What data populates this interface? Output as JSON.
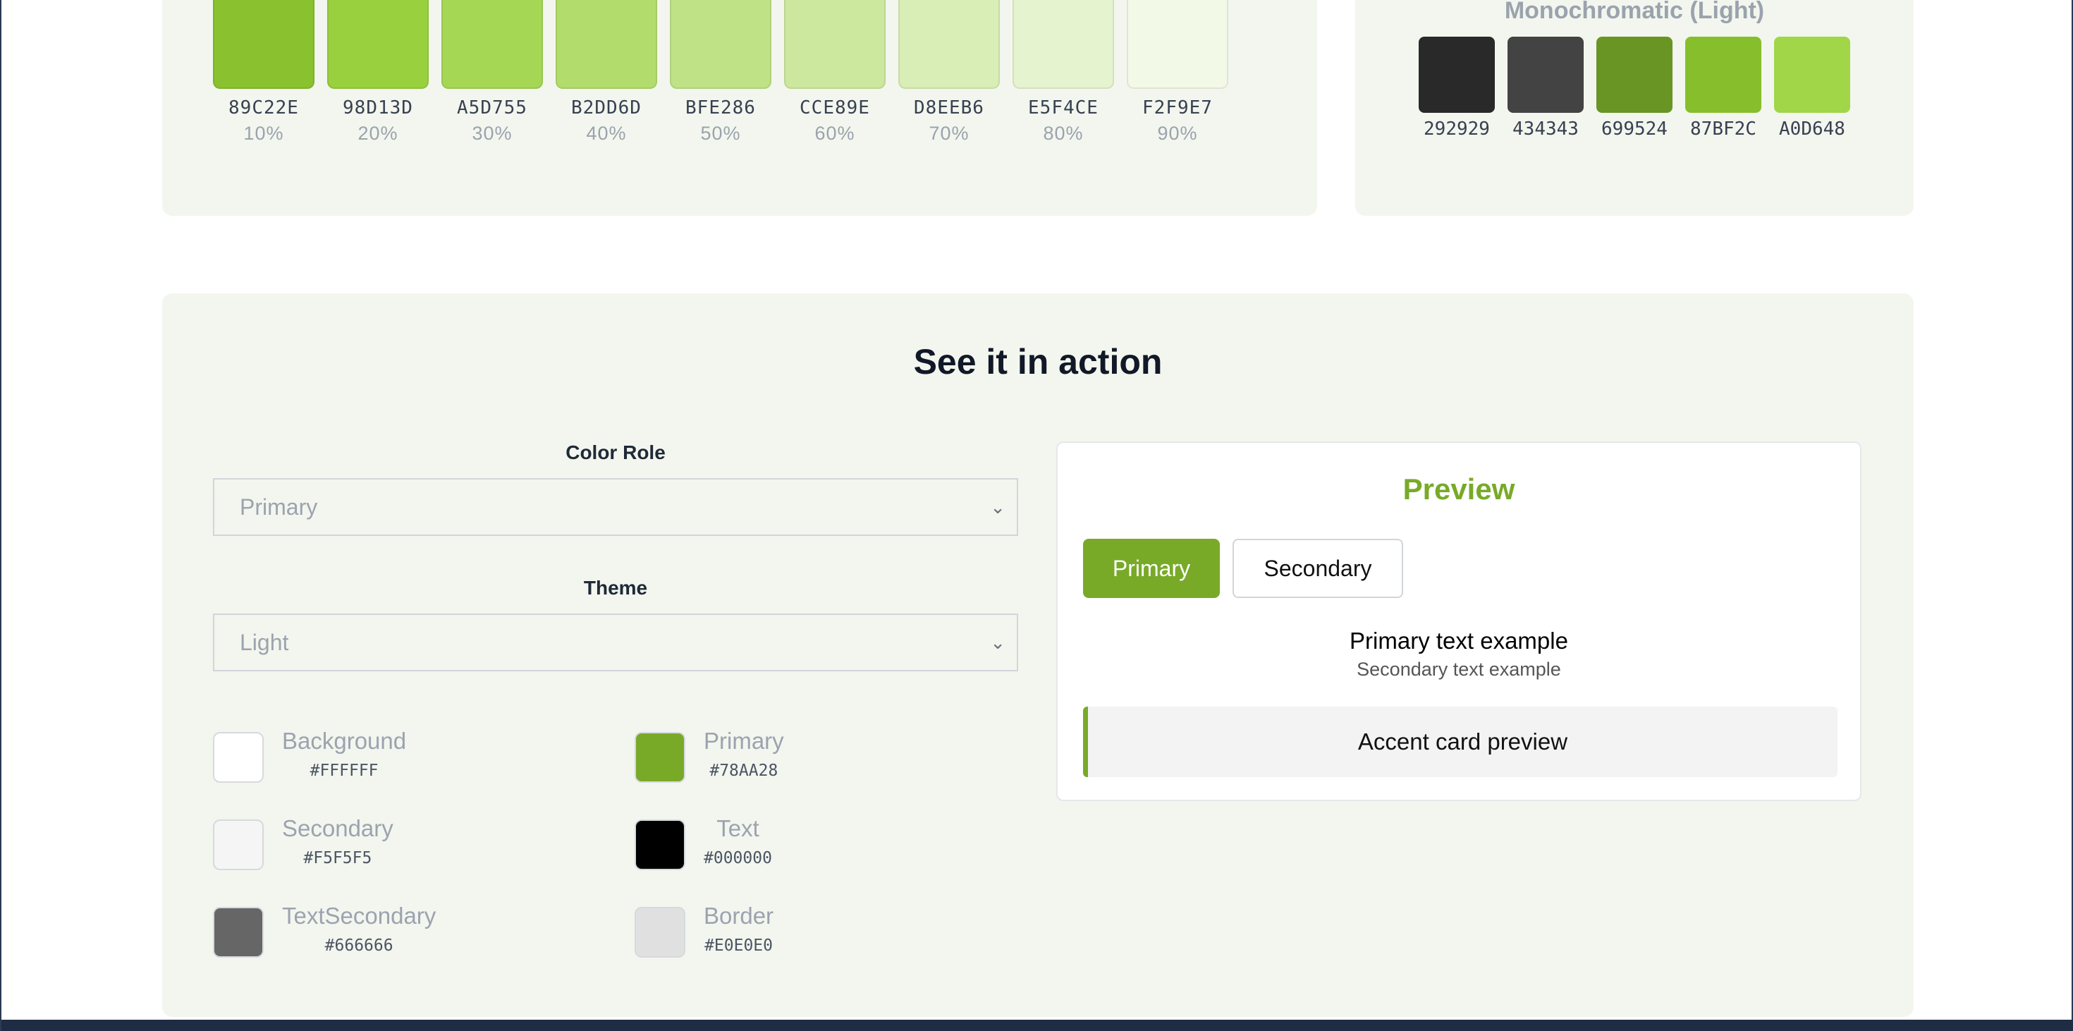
{
  "tints": [
    {
      "hex": "89C22E",
      "pct": "10%",
      "color": "#89C22E"
    },
    {
      "hex": "98D13D",
      "pct": "20%",
      "color": "#98D13D"
    },
    {
      "hex": "A5D755",
      "pct": "30%",
      "color": "#A5D755"
    },
    {
      "hex": "B2DD6D",
      "pct": "40%",
      "color": "#B2DD6D"
    },
    {
      "hex": "BFE286",
      "pct": "50%",
      "color": "#BFE286"
    },
    {
      "hex": "CCE89E",
      "pct": "60%",
      "color": "#CCE89E"
    },
    {
      "hex": "D8EEB6",
      "pct": "70%",
      "color": "#D8EEB6"
    },
    {
      "hex": "E5F4CE",
      "pct": "80%",
      "color": "#E5F4CE"
    },
    {
      "hex": "F2F9E7",
      "pct": "90%",
      "color": "#F2F9E7"
    }
  ],
  "monochromatic": {
    "title": "Monochromatic (Light)",
    "swatches": [
      {
        "hex": "292929",
        "color": "#292929"
      },
      {
        "hex": "434343",
        "color": "#434343"
      },
      {
        "hex": "699524",
        "color": "#699524"
      },
      {
        "hex": "87BF2C",
        "color": "#87BF2C"
      },
      {
        "hex": "A0D648",
        "color": "#A0D648"
      }
    ]
  },
  "action": {
    "title": "See it in action",
    "color_role_label": "Color Role",
    "color_role_value": "Primary",
    "theme_label": "Theme",
    "theme_value": "Light",
    "roles": [
      {
        "name": "Background",
        "code": "#FFFFFF",
        "color": "#FFFFFF"
      },
      {
        "name": "Primary",
        "code": "#78AA28",
        "color": "#78AA28"
      },
      {
        "name": "Secondary",
        "code": "#F5F5F5",
        "color": "#F5F5F5"
      },
      {
        "name": "Text",
        "code": "#000000",
        "color": "#000000"
      },
      {
        "name": "TextSecondary",
        "code": "#666666",
        "color": "#666666"
      },
      {
        "name": "Border",
        "code": "#E0E0E0",
        "color": "#E0E0E0"
      }
    ]
  },
  "preview": {
    "title": "Preview",
    "primary_button": "Primary",
    "secondary_button": "Secondary",
    "primary_text": "Primary text example",
    "secondary_text": "Secondary text example",
    "accent_card": "Accent card preview",
    "accent_color": "#78AA28"
  }
}
